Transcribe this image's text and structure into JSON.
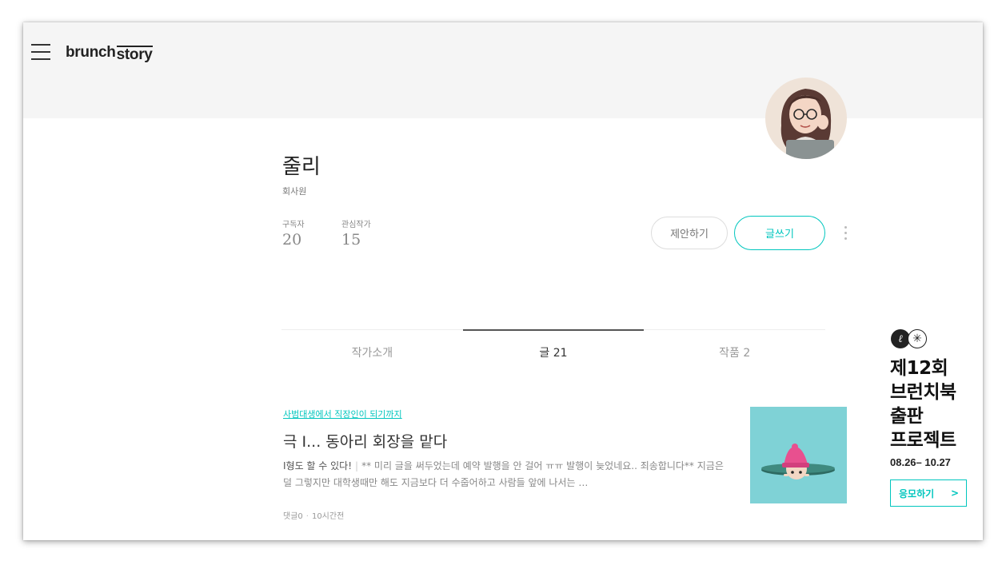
{
  "header": {
    "logo_brunch": "brunch",
    "logo_story": "story"
  },
  "profile": {
    "name": "줄리",
    "job": "회사원",
    "stats": [
      {
        "label": "구독자",
        "value": "20"
      },
      {
        "label": "관심작가",
        "value": "15"
      }
    ],
    "suggest_label": "제안하기",
    "write_label": "글쓰기"
  },
  "tabs": [
    {
      "label": "작가소개",
      "active": false
    },
    {
      "label": "글 21",
      "active": true
    },
    {
      "label": "작품 2",
      "active": false
    }
  ],
  "article": {
    "magazine": "사범대생에서 직장인이 되기까지",
    "title": "극 I... 동아리 회장을 맡다",
    "lead": "I형도 할 수 있다!",
    "body": "** 미리 글을 써두었는데 예약 발행을 안 걸어 ㅠㅠ 발행이 늦었네요.. 죄송합니다** 지금은 덜 그렇지만 대학생때만 해도 지금보다 더 수줍어하고 사람들 앞에 나서는 …",
    "comments": "댓글0",
    "time": "10시간전"
  },
  "promo": {
    "title_lines": [
      "제12회",
      "브런치북",
      "출판",
      "프로젝트"
    ],
    "date": "08.26– 10.27",
    "button_label": "응모하기",
    "button_arrow": ">"
  },
  "colors": {
    "accent": "#00c6be",
    "cover_bg": "#f5f5f5",
    "thumb_bg": "#7fd2d6"
  }
}
